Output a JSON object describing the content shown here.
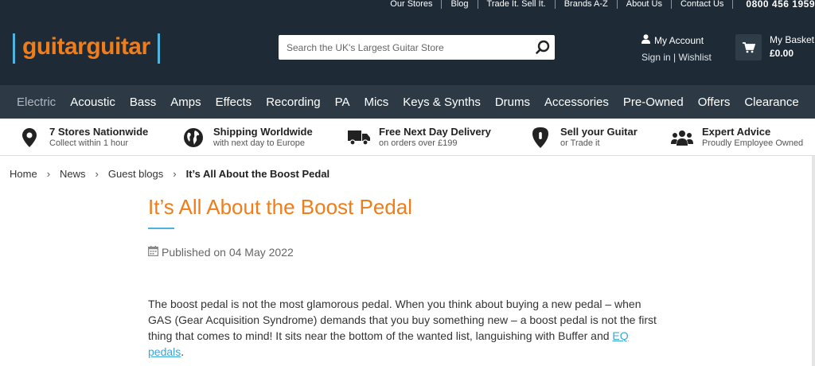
{
  "header": {
    "top_links": [
      "Our Stores",
      "Blog",
      "Trade It. Sell It.",
      "Brands A-Z",
      "About Us",
      "Contact Us"
    ],
    "phone": "0800 456 1959",
    "logo_text": "guitarguitar",
    "search_placeholder": "Search the UK's Largest Guitar Store",
    "account": {
      "title": "My Account",
      "sign_in": "Sign in",
      "divider": "|",
      "wishlist": "Wishlist"
    },
    "basket": {
      "label": "My Basket",
      "amount": "£0.00"
    }
  },
  "nav": {
    "categories": [
      "Electric",
      "Acoustic",
      "Bass",
      "Amps",
      "Effects",
      "Recording",
      "PA",
      "Mics",
      "Keys & Synths",
      "Drums",
      "Accessories",
      "Pre-Owned",
      "Offers",
      "Clearance"
    ]
  },
  "usp": [
    {
      "icon": "map-pin-icon",
      "title": "7 Stores Nationwide",
      "subtitle": "Collect within 1 hour"
    },
    {
      "icon": "globe-icon",
      "title": "Shipping Worldwide",
      "subtitle": "with next day to Europe"
    },
    {
      "icon": "truck-icon",
      "title": "Free Next Day Delivery",
      "subtitle": "on orders over £199"
    },
    {
      "icon": "guitar-pick-icon",
      "title": "Sell your Guitar",
      "subtitle": "or Trade it"
    },
    {
      "icon": "users-icon",
      "title": "Expert Advice",
      "subtitle": "Proudly Employee Owned"
    }
  ],
  "breadcrumb": {
    "home": "Home",
    "news": "News",
    "guest_blogs": "Guest blogs",
    "current": "It’s All About the Boost Pedal"
  },
  "article": {
    "title": "It’s All About the Boost Pedal",
    "published": "Published on 04 May 2022",
    "body_text": "The boost pedal is not the most glamorous pedal. When you think about buying a new pedal – when GAS (Gear Acquisition Syndrome) demands that you buy something new – a boost pedal is not the first thing that comes to mind! It sits near the bottom of the wanted list, languishing with Buffer and ",
    "body_link": "EQ pedals",
    "body_end": "."
  },
  "colors": {
    "header_bg": "#1e2a35",
    "nav_bg": "#2d3a46",
    "brand_orange": "#f07d1a",
    "accent_blue": "#4fb3e0"
  }
}
